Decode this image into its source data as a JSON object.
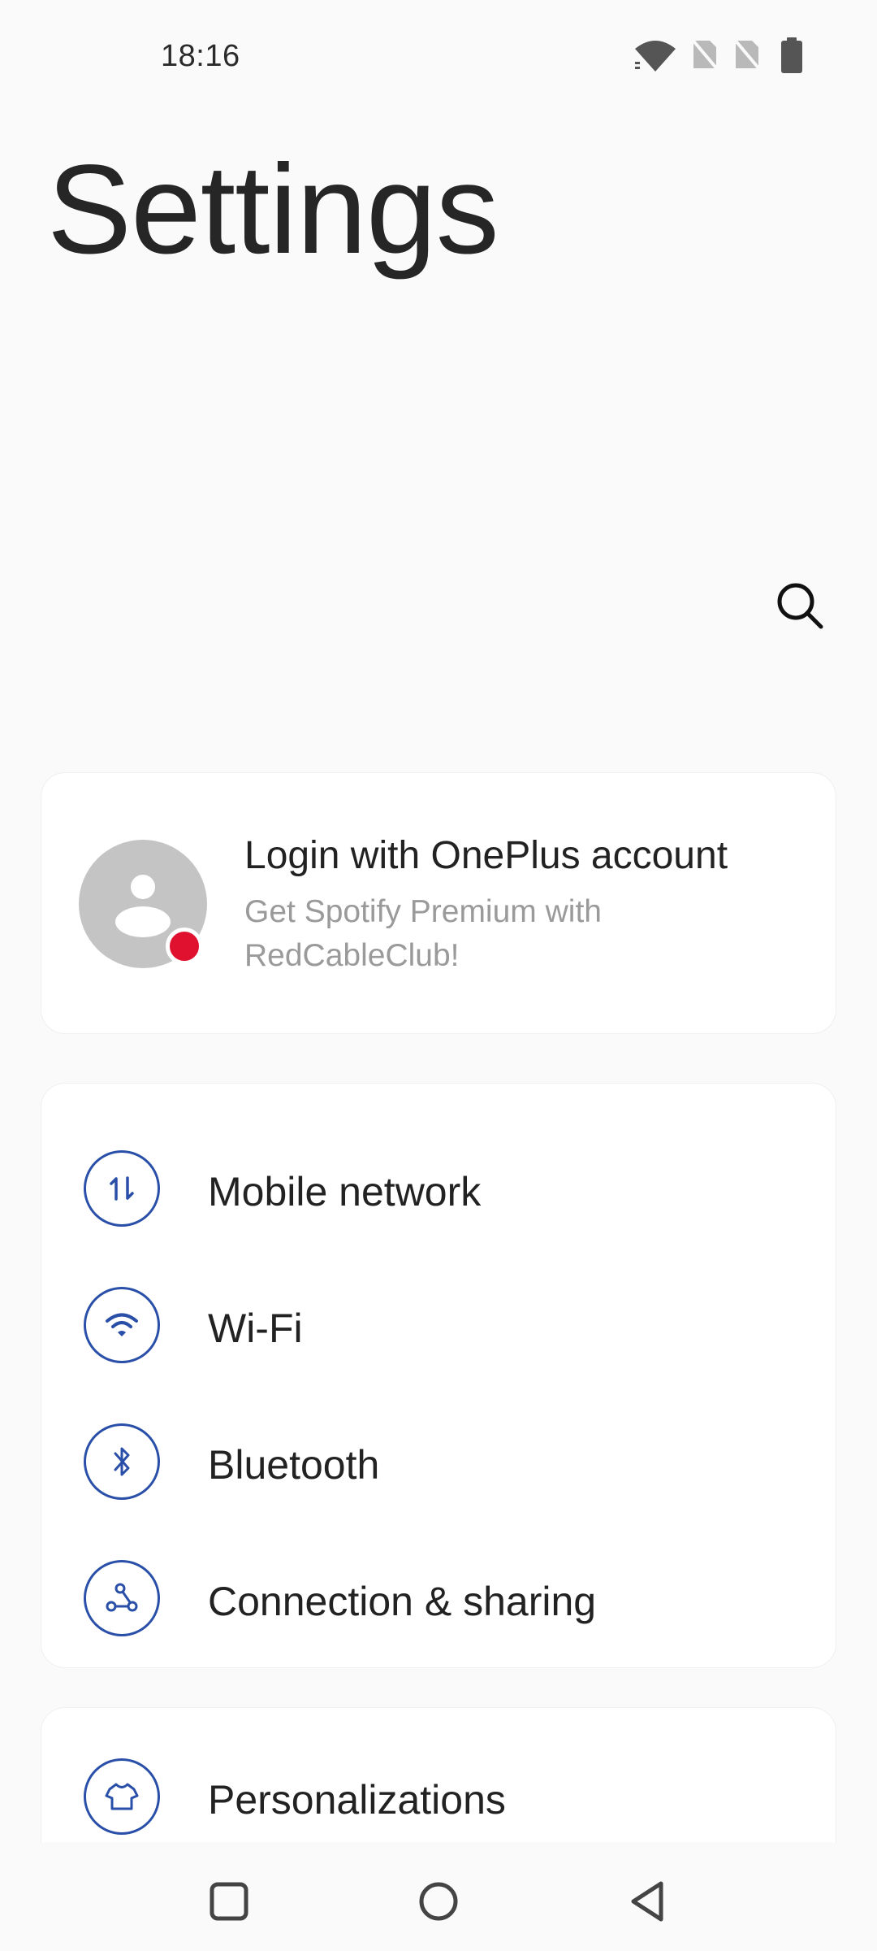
{
  "status_bar": {
    "time": "18:16",
    "icons": [
      "wifi-icon",
      "no-sim-icon",
      "no-sim-icon",
      "battery-icon"
    ]
  },
  "header": {
    "title": "Settings",
    "search_icon": "search-icon"
  },
  "account": {
    "title": "Login with OnePlus account",
    "subtitle": "Get Spotify Premium with RedCableClub!",
    "avatar_icon": "person-icon",
    "badge_color": "#e0102f"
  },
  "network_items": [
    {
      "label": "Mobile network",
      "icon": "mobile-data-icon"
    },
    {
      "label": "Wi-Fi",
      "icon": "wifi-icon"
    },
    {
      "label": "Bluetooth",
      "icon": "bluetooth-icon"
    },
    {
      "label": "Connection & sharing",
      "icon": "share-icon"
    }
  ],
  "personal_items": [
    {
      "label": "Personalizations",
      "icon": "tshirt-icon"
    }
  ],
  "nav": {
    "recents": "recents-icon",
    "home": "home-icon",
    "back": "back-icon"
  },
  "colors": {
    "accent": "#2a4fa8",
    "background": "#fafafa",
    "card": "#ffffff"
  }
}
